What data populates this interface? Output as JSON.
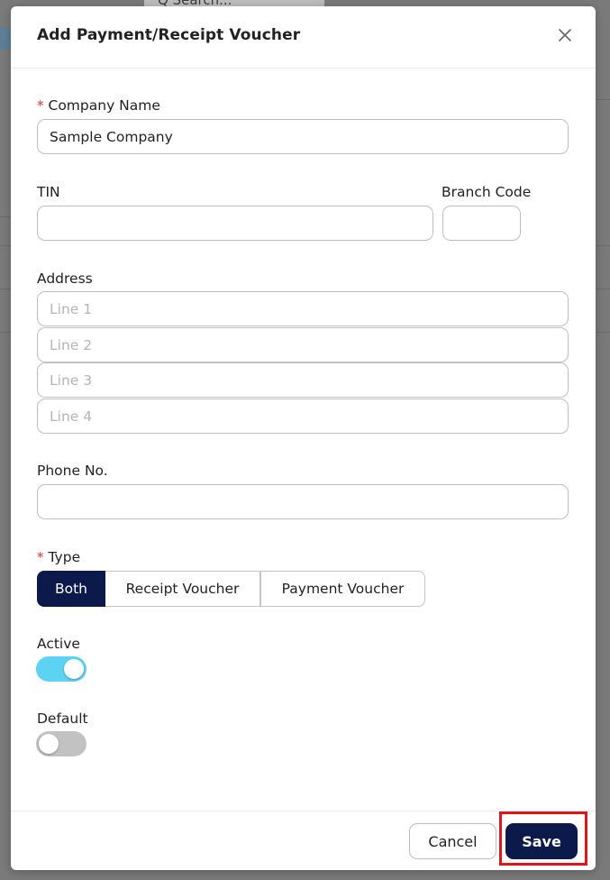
{
  "background": {
    "search_placeholder": "Q  Search..."
  },
  "modal": {
    "title": "Add Payment/Receipt Voucher",
    "company_name": {
      "label": "Company Name",
      "required_mark": "*",
      "value": "Sample Company"
    },
    "tin": {
      "label": "TIN",
      "value": ""
    },
    "branch_code": {
      "label": "Branch Code",
      "value": ""
    },
    "address": {
      "label": "Address",
      "lines": [
        {
          "placeholder": "Line 1",
          "value": ""
        },
        {
          "placeholder": "Line 2",
          "value": ""
        },
        {
          "placeholder": "Line 3",
          "value": ""
        },
        {
          "placeholder": "Line 4",
          "value": ""
        }
      ]
    },
    "phone": {
      "label": "Phone No.",
      "value": ""
    },
    "type": {
      "label": "Type",
      "required_mark": "*",
      "options": [
        "Both",
        "Receipt Voucher",
        "Payment Voucher"
      ],
      "selected": "Both"
    },
    "active": {
      "label": "Active",
      "value": true
    },
    "default": {
      "label": "Default",
      "value": false
    },
    "footer": {
      "cancel_label": "Cancel",
      "save_label": "Save"
    }
  },
  "colors": {
    "primary": "#0b1a4b",
    "toggle_on": "#5dd3f3",
    "toggle_off": "#c2c2c2",
    "required": "#e0312f",
    "highlight": "#e0141b"
  }
}
